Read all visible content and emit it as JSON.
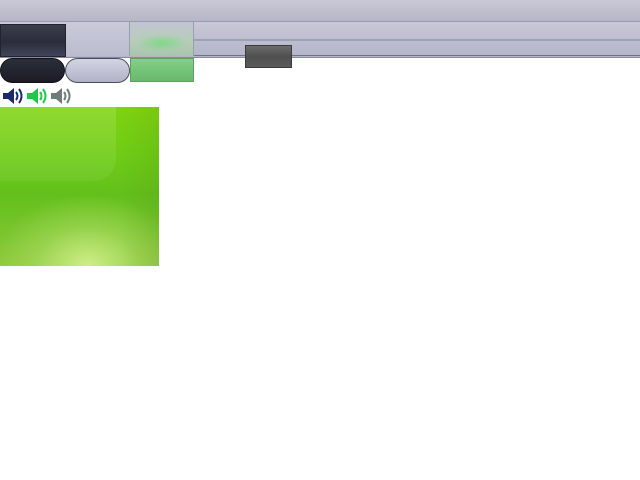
{
  "window": {
    "title": ""
  },
  "tabs": [
    {
      "label": "",
      "state": "selected-dark"
    },
    {
      "label": "",
      "state": "normal"
    },
    {
      "label": "",
      "state": "hover-green"
    }
  ],
  "buttons": [
    {
      "label": "",
      "style": "dark-pill"
    },
    {
      "label": "",
      "style": "light-pill"
    },
    {
      "label": "",
      "style": "green"
    }
  ],
  "icons": [
    {
      "name": "speaker-icon",
      "color": "#1a2a6c"
    },
    {
      "name": "speaker-icon",
      "color": "#1ec84a"
    },
    {
      "name": "speaker-icon",
      "color": "#6f7d78"
    }
  ],
  "colors": {
    "dark": "#2b2d3b",
    "light": "#c6c7d8",
    "green": "#74c378",
    "panel_green": "#6fcc15"
  }
}
